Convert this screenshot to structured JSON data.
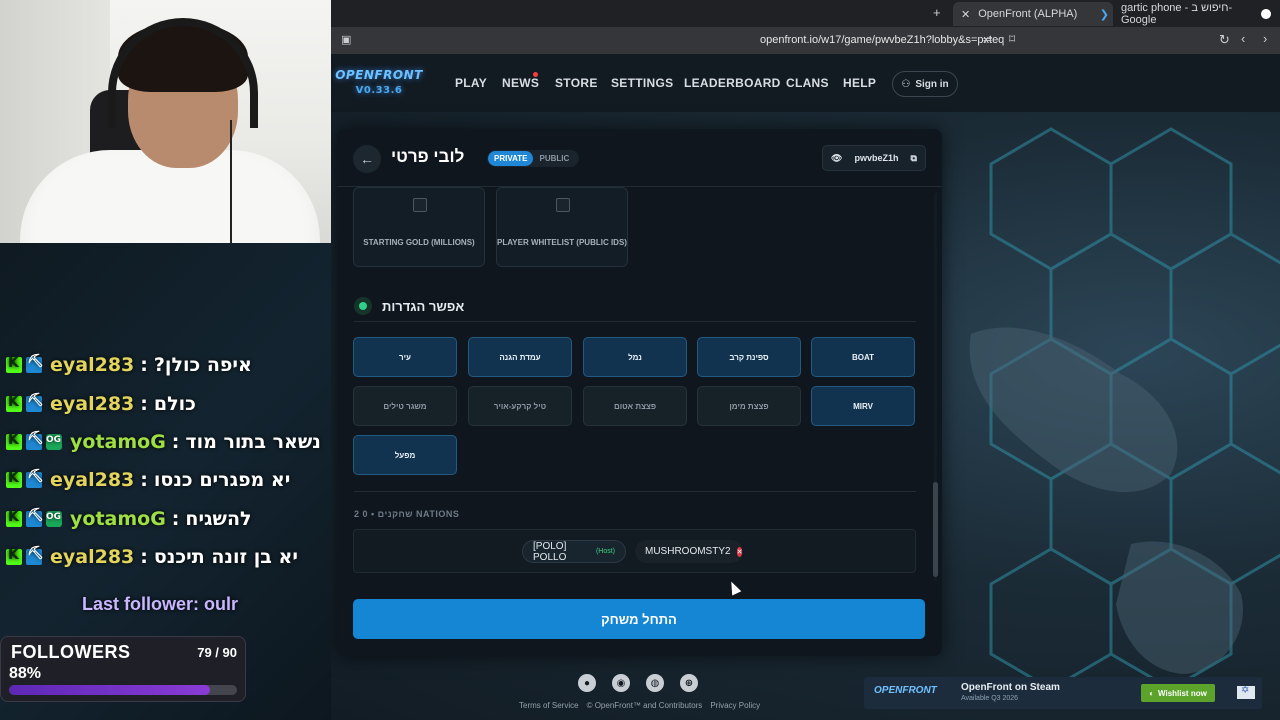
{
  "stream": {
    "chat": [
      {
        "user": "eyal283",
        "message": "?איפה כולן",
        "badges": [
          "kick",
          "pickaxe"
        ],
        "user_color": "#e2d45c"
      },
      {
        "user": "eyal283",
        "message": "כולם",
        "badges": [
          "kick",
          "pickaxe"
        ],
        "user_color": "#e2d45c"
      },
      {
        "user": "yotamoG",
        "message": "נשאר בתור מוד",
        "badges": [
          "kick",
          "pickaxe",
          "og"
        ],
        "user_color": "#9fdf41"
      },
      {
        "user": "eyal283",
        "message": "יא מפגרים כנסו",
        "badges": [
          "kick",
          "pickaxe"
        ],
        "user_color": "#e2d45c"
      },
      {
        "user": "yotamoG",
        "message": "להשגיח",
        "badges": [
          "kick",
          "pickaxe",
          "og"
        ],
        "user_color": "#9fdf41"
      },
      {
        "user": "eyal283",
        "message": "יא בן זונה תיכנס",
        "badges": [
          "kick",
          "pickaxe"
        ],
        "user_color": "#e2d45c"
      }
    ],
    "last_follower": "Last follower: oulr",
    "followers": {
      "title": "FOLLOWERS",
      "count": "79 / 90",
      "percent": "88%",
      "progress": 0.88
    }
  },
  "browser": {
    "tabs": [
      {
        "label": "OpenFront (ALPHA)",
        "active": true
      },
      {
        "label": "gartic phone - חיפוש ב-Google",
        "active": false
      }
    ],
    "url": "openfront.io/w17/game/pwvbeZ1h?lobby&s=pxteq"
  },
  "site": {
    "logo": "OPENFRONT",
    "version": "V0.33.6",
    "nav": [
      "PLAY",
      "NEWS",
      "STORE",
      "SETTINGS",
      "LEADERBOARD",
      "CLANS",
      "HELP"
    ],
    "signin": "Sign in"
  },
  "lobby": {
    "title": "לובי פרטי",
    "visibility": {
      "private": "PRIVATE",
      "public": "PUBLIC",
      "selected": "private"
    },
    "code": "pwvbeZ1h",
    "options": [
      {
        "label": "STARTING GOLD (MILLIONS)",
        "checked": false
      },
      {
        "label": "PLAYER WHITELIST (PUBLIC IDS)",
        "checked": false
      }
    ],
    "units_section_title": "אפשר הגדרות",
    "units": [
      {
        "label": "עיר",
        "enabled": true
      },
      {
        "label": "עמדת הגנה",
        "enabled": true
      },
      {
        "label": "נמל",
        "enabled": true
      },
      {
        "label": "ספינת קרב",
        "enabled": true
      },
      {
        "label": "BOAT",
        "enabled": true
      },
      {
        "label": "משגר טילים",
        "enabled": false
      },
      {
        "label": "טיל קרקע-אויר",
        "enabled": false
      },
      {
        "label": "פצצת אטום",
        "enabled": false
      },
      {
        "label": "פצצת מימן",
        "enabled": false
      },
      {
        "label": "MIRV",
        "enabled": true
      },
      {
        "label": "מפעל",
        "enabled": true
      }
    ],
    "players_label": "2 0  •  שחקנים NATIONS",
    "players": [
      {
        "name": "[POLO] POLLO",
        "tag": "(Host)"
      },
      {
        "name": "MUSHROOMSTY2",
        "tag": ""
      }
    ],
    "start_button": "התחל משחק"
  },
  "footer": {
    "icons": [
      "github-icon",
      "reddit-icon",
      "discord-icon",
      "globe-icon"
    ],
    "links": [
      "Terms of Service",
      "© OpenFront™ and Contributors",
      "Privacy Policy"
    ]
  },
  "steam_banner": {
    "logo": "OPENFRONT",
    "title": "OpenFront on Steam",
    "subtitle": "Available Q3 2026",
    "button": "Wishlist now"
  }
}
